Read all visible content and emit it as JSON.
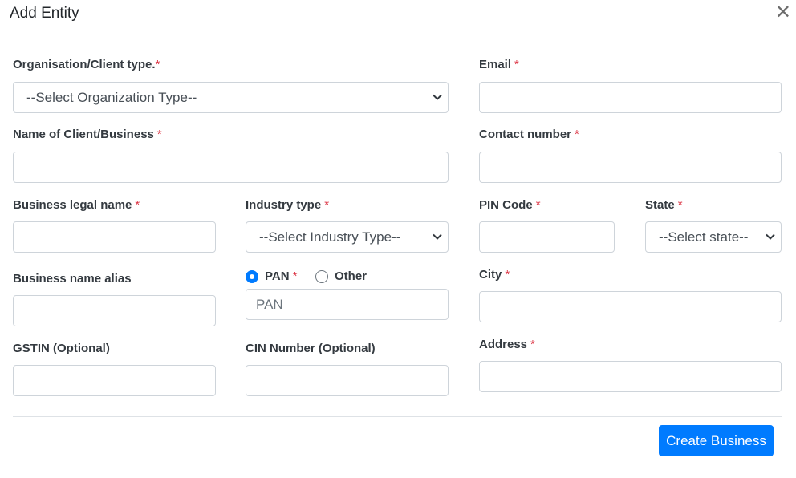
{
  "modal": {
    "title": "Add Entity",
    "close_icon": "close-icon"
  },
  "form": {
    "org_type": {
      "label": "Organisation/Client type.",
      "required": "*",
      "selected": "--Select Organization Type--"
    },
    "client_name": {
      "label": "Name of Client/Business",
      "required": "*",
      "value": ""
    },
    "legal_name": {
      "label": "Business legal name",
      "required": "*",
      "value": ""
    },
    "industry_type": {
      "label": "Industry type",
      "required": "*",
      "selected": "--Select Industry Type--"
    },
    "alias": {
      "label": "Business name alias",
      "value": ""
    },
    "id_type": {
      "options": [
        {
          "label": "PAN",
          "required": "*",
          "checked": true
        },
        {
          "label": "Other",
          "checked": false
        }
      ],
      "placeholder": "PAN"
    },
    "gstin": {
      "label": "GSTIN (Optional)",
      "value": ""
    },
    "cin": {
      "label": "CIN Number (Optional)",
      "value": ""
    },
    "email": {
      "label": "Email",
      "required": "*",
      "value": ""
    },
    "contact": {
      "label": "Contact number",
      "required": "*",
      "value": ""
    },
    "pin": {
      "label": "PIN Code",
      "required": "*",
      "value": ""
    },
    "state": {
      "label": "State",
      "required": "*",
      "selected": "--Select state--"
    },
    "city": {
      "label": "City",
      "required": "*",
      "value": ""
    },
    "address": {
      "label": "Address",
      "required": "*",
      "value": ""
    }
  },
  "footer": {
    "submit_label": "Create Business"
  },
  "colors": {
    "primary": "#007bff",
    "required": "#dc3545",
    "border": "#ced4da"
  }
}
